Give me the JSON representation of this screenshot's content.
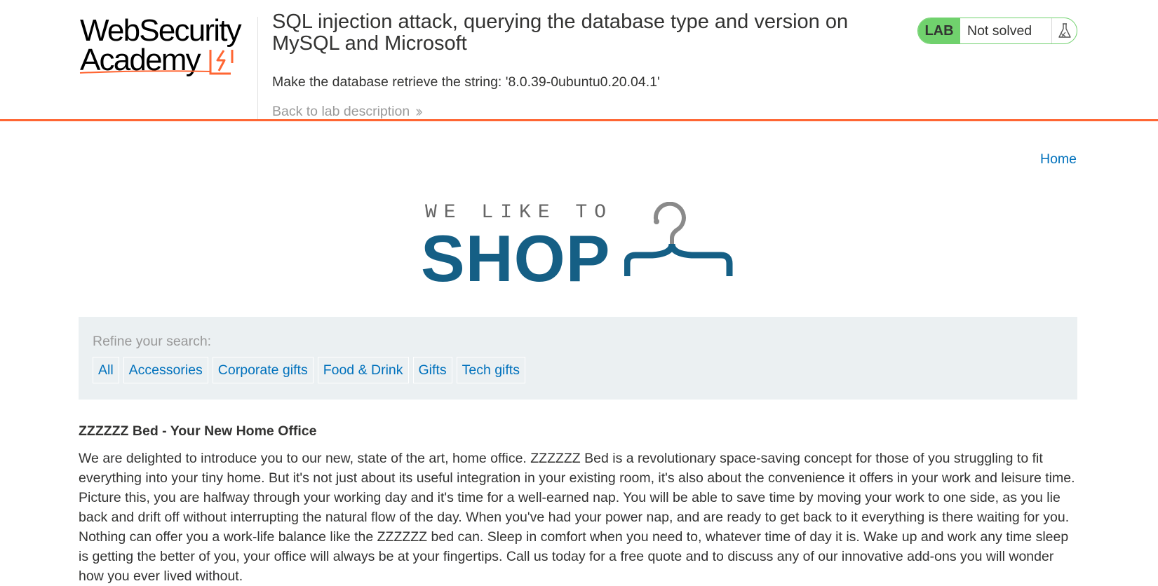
{
  "academy": {
    "logo_line1": "WebSecurity",
    "logo_line2": "Academy",
    "lab_title": "SQL injection attack, querying the database type and version on MySQL and Microsoft",
    "lab_goal": "Make the database retrieve the string: '8.0.39-0ubuntu0.20.04.1'",
    "back_link": "Back to lab description",
    "lab_badge": "LAB",
    "lab_status": "Not solved",
    "status_icon": "flask-icon",
    "accent_color": "#ff6633",
    "status_color": "#70d16d"
  },
  "nav": {
    "home": "Home"
  },
  "banner": {
    "top_text": "WE LIKE TO",
    "main_text": "SHOP",
    "icon": "hanger-icon",
    "brand_color": "#155f85"
  },
  "filters": {
    "label": "Refine your search:",
    "items": [
      "All",
      "Accessories",
      "Corporate gifts",
      "Food & Drink",
      "Gifts",
      "Tech gifts"
    ],
    "link_color": "#0071bc"
  },
  "product": {
    "title": "ZZZZZZ Bed - Your New Home Office",
    "description": "We are delighted to introduce you to our new, state of the art, home office. ZZZZZZ Bed is a revolutionary space-saving concept for those of you struggling to fit everything into your tiny home. But it's not just about its useful integration in your existing room, it's also about the convenience it offers in your work and leisure time. Picture this, you are halfway through your working day and it's time for a well-earned nap. You will be able to save time by moving your work to one side, as you lie back and drift off without interrupting the natural flow of the day. When you've had your power nap, and are ready to get back to it everything is there waiting for you. Nothing can offer you a work-life balance like the ZZZZZZ bed can. Sleep in comfort when you need to, whatever time of day it is. Wake up and work any time sleep is getting the better of you, your office will always be at your fingertips. Call us today for a free quote and to discuss any of our innovative add-ons you will wonder how you ever lived without."
  }
}
